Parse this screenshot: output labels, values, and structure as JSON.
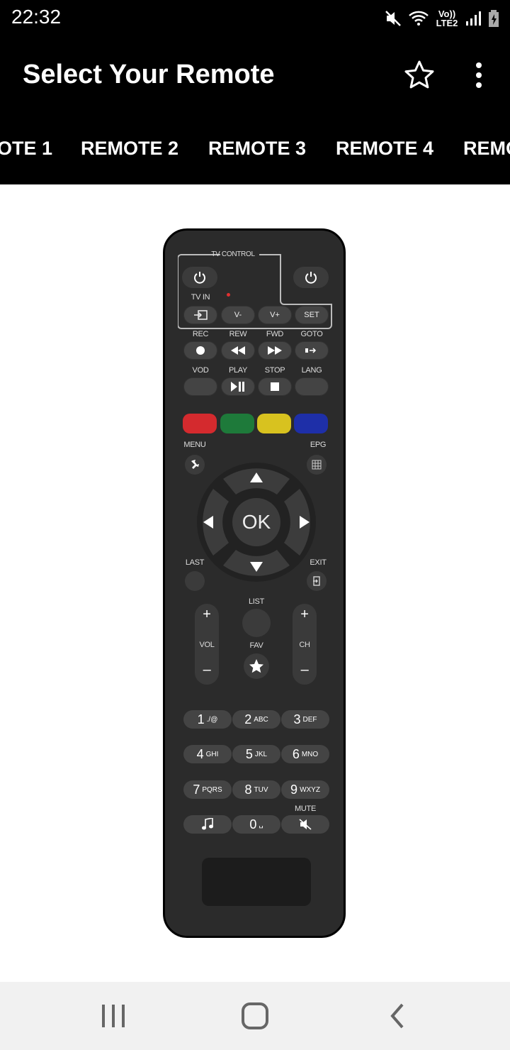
{
  "status_bar": {
    "time": "22:32",
    "network": "Vo)) LTE2"
  },
  "app_bar": {
    "title": "Select Your Remote"
  },
  "tabs": [
    "OTE 1",
    "REMOTE 2",
    "REMOTE 3",
    "REMOTE 4",
    "REMO"
  ],
  "remote": {
    "tv_control": "TV CONTROL",
    "tv_in": "TV IN",
    "top_row": [
      "V-",
      "V+",
      "SET"
    ],
    "transport_labels": [
      "REC",
      "REW",
      "FWD",
      "GOTO"
    ],
    "play_labels": [
      "VOD",
      "PLAY",
      "STOP",
      "LANG"
    ],
    "menu": "MENU",
    "epg": "EPG",
    "ok": "OK",
    "last": "LAST",
    "exit": "EXIT",
    "list": "LIST",
    "vol": "VOL",
    "fav": "FAV",
    "ch": "CH",
    "plus": "+",
    "minus": "–",
    "mute": "MUTE",
    "numbers": [
      {
        "n": "1",
        "s": "./@"
      },
      {
        "n": "2",
        "s": "ABC"
      },
      {
        "n": "3",
        "s": "DEF"
      },
      {
        "n": "4",
        "s": "GHI"
      },
      {
        "n": "5",
        "s": "JKL"
      },
      {
        "n": "6",
        "s": "MNO"
      },
      {
        "n": "7",
        "s": "PQRS"
      },
      {
        "n": "8",
        "s": "TUV"
      },
      {
        "n": "9",
        "s": "WXYZ"
      },
      {
        "n": "0",
        "s": "␣"
      }
    ],
    "color_keys": [
      "#d42a2e",
      "#1e7a3a",
      "#d8c21f",
      "#1e2fa8"
    ]
  }
}
